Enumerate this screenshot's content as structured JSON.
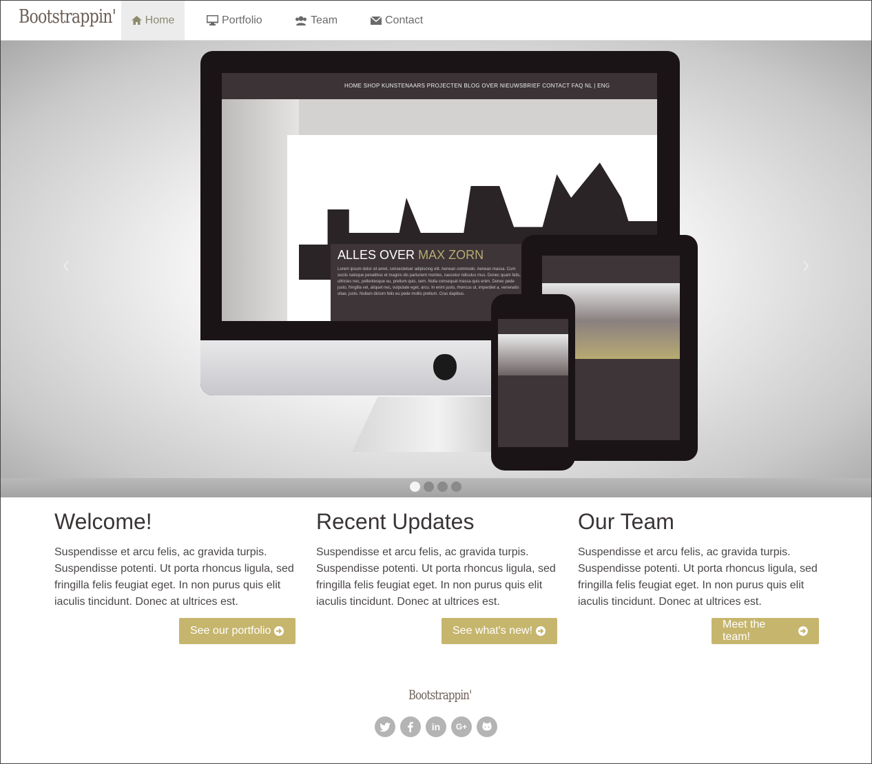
{
  "brand": "Bootstrappin'",
  "nav": {
    "home": "Home",
    "portfolio": "Portfolio",
    "team": "Team",
    "contact": "Contact"
  },
  "carousel": {
    "active_slide": 1,
    "slide_count": 4,
    "prev_icon": "chevron-left-icon",
    "next_icon": "chevron-right-icon",
    "screen": {
      "menu": "HOME  SHOP  KUNSTENAARS  PROJECTEN  BLOG  OVER  NIEUWSBRIEF  CONTACT  FAQ     NL | ENG",
      "caption_title": "ALLES OVER",
      "caption_highlight": "MAX ZORN",
      "caption_text": "Lorem ipsum dolor sit amet, consectetuer adipiscing elit. Aenean commodo. Aenean massa. Cum sociis natoque penatibus et magnis dis parturient montes, nascetur ridiculus mus. Donec quam felis, ultricies nec, pellentesque eu, pretium quis, sem. Nulla consequat massa quis enim. Donec pede justo, fringilla vel, aliquet nec, vulputate eget, arcu. In enim justo, rhoncus ut, imperdiet a, venenatis vitae, justo. Nullam dictum felis eu pede mollis pretium. Cras dapibus."
    }
  },
  "columns": [
    {
      "title": "Welcome!",
      "text": "Suspendisse et arcu felis, ac gravida turpis. Suspendisse potenti. Ut porta rhoncus ligula, sed fringilla felis feugiat eget. In non purus quis elit iaculis tincidunt. Donec at ultrices est.",
      "button": "See our portfolio"
    },
    {
      "title": "Recent Updates",
      "text": "Suspendisse et arcu felis, ac gravida turpis. Suspendisse potenti. Ut porta rhoncus ligula, sed fringilla felis feugiat eget. In non purus quis elit iaculis tincidunt. Donec at ultrices est.",
      "button": "See what's new!"
    },
    {
      "title": "Our Team",
      "text": "Suspendisse et arcu felis, ac gravida turpis. Suspendisse potenti. Ut porta rhoncus ligula, sed fringilla felis feugiat eget. In non purus quis elit iaculis tincidunt. Donec at ultrices est.",
      "button": "Meet the team!"
    }
  ],
  "footer": {
    "brand": "Bootstrappin'",
    "social_icons": [
      "twitter-icon",
      "facebook-icon",
      "linkedin-icon",
      "google-plus-icon",
      "github-icon"
    ]
  },
  "colors": {
    "accent": "#c6b56d",
    "brand": "#6b5e57",
    "nav_active_bg": "#ececec"
  }
}
